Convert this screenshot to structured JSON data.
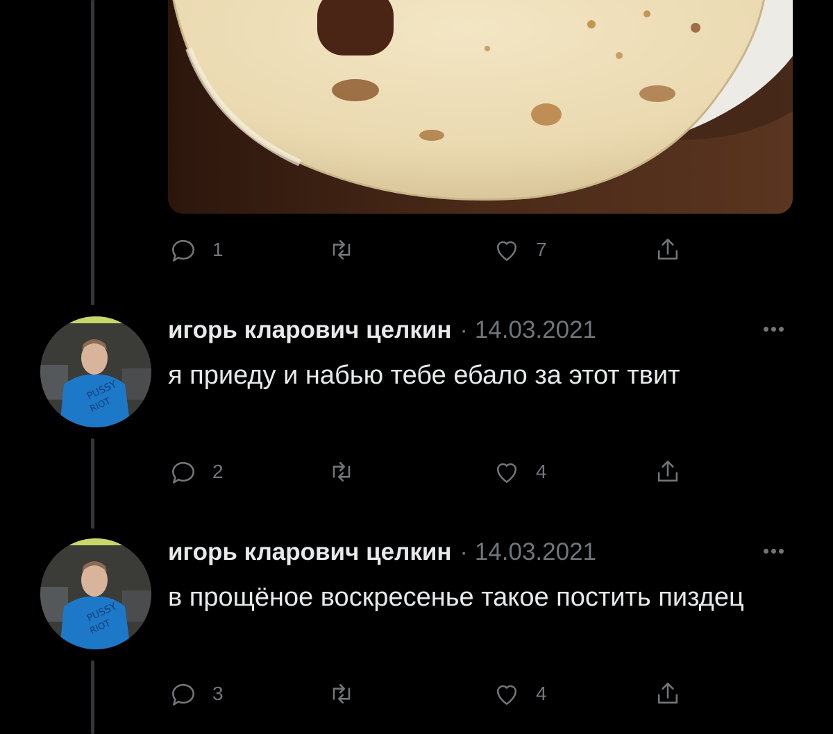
{
  "first_tweet": {
    "media_alt": "photo of a crepe on a plate",
    "stats": {
      "replies": "1",
      "retweets": "",
      "likes": "7"
    }
  },
  "replies": [
    {
      "author": "игорь кларович целкин",
      "separator": "·",
      "date": "14.03.2021",
      "text": "я приеду и набью тебе ебало за этот твит",
      "stats": {
        "replies": "2",
        "retweets": "",
        "likes": "4"
      }
    },
    {
      "author": "игорь кларович целкин",
      "separator": "·",
      "date": "14.03.2021",
      "text": "в прощёное воскресенье такое постить пиздец",
      "stats": {
        "replies": "3",
        "retweets": "",
        "likes": "4"
      }
    }
  ],
  "colors": {
    "background": "#000000",
    "text": "#e7e9ea",
    "muted": "#71767b",
    "thread_line": "#333639"
  }
}
